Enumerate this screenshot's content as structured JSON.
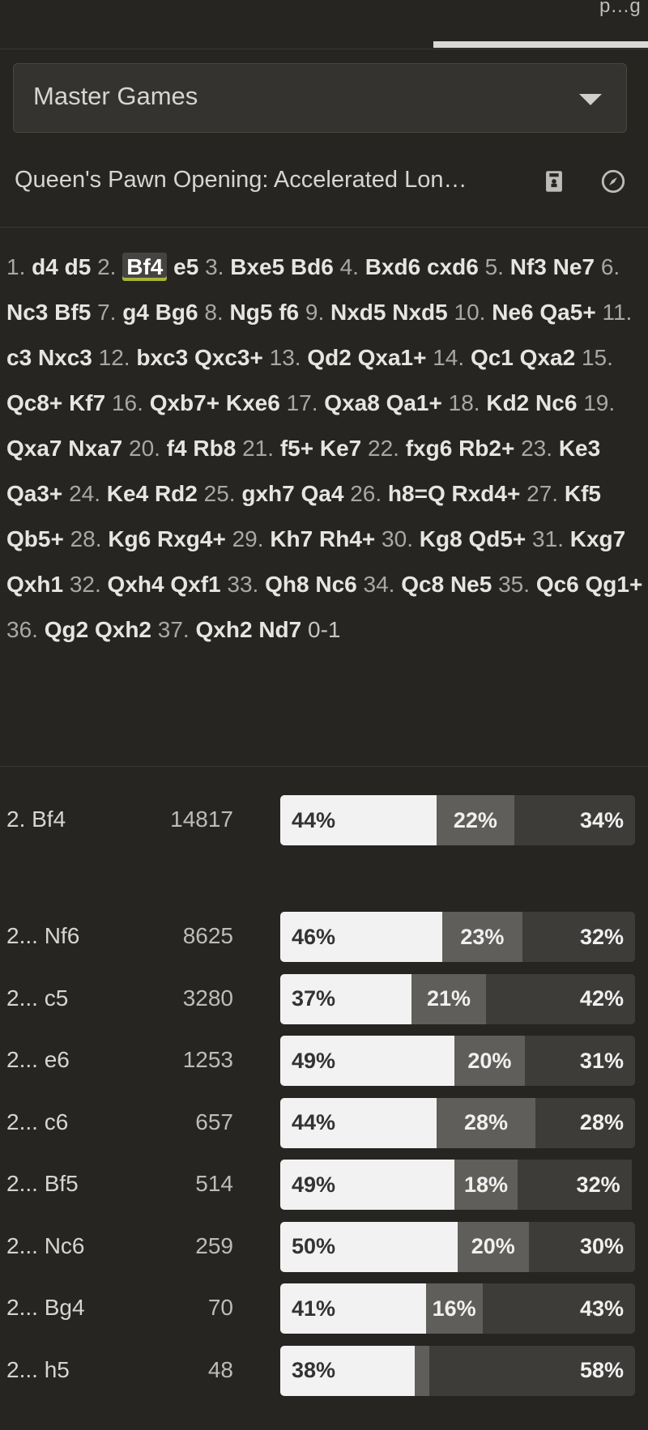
{
  "top": {
    "tab_clip": "p…g"
  },
  "source": {
    "selected": "Master Games"
  },
  "opening": {
    "name": "Queen's Pawn Opening: Accelerated Lon…"
  },
  "icons": {
    "book": "book-icon",
    "compass": "compass-icon",
    "chevron": "chevron-down-icon"
  },
  "colors": {
    "background": "#262522",
    "white": "#f2f2f2",
    "draw": "#5f5e5b",
    "black": "#3d3c39",
    "highlight": "#a9b33a"
  },
  "game_tokens": [
    {
      "t": "1.",
      "k": "num"
    },
    {
      "t": "d4",
      "k": "mv"
    },
    {
      "t": "d5",
      "k": "mv"
    },
    {
      "t": "2.",
      "k": "num"
    },
    {
      "t": "Bf4",
      "k": "mv",
      "current": true
    },
    {
      "t": "e5",
      "k": "mv"
    },
    {
      "t": "3.",
      "k": "num"
    },
    {
      "t": "Bxe5",
      "k": "mv"
    },
    {
      "t": "Bd6",
      "k": "mv"
    },
    {
      "t": "4.",
      "k": "num"
    },
    {
      "t": "Bxd6",
      "k": "mv"
    },
    {
      "t": "cxd6",
      "k": "mv"
    },
    {
      "t": "5.",
      "k": "num"
    },
    {
      "t": "Nf3",
      "k": "mv"
    },
    {
      "t": "Ne7",
      "k": "mv"
    },
    {
      "t": "6.",
      "k": "num"
    },
    {
      "t": "Nc3",
      "k": "mv"
    },
    {
      "t": "Bf5",
      "k": "mv"
    },
    {
      "t": "7.",
      "k": "num"
    },
    {
      "t": "g4",
      "k": "mv"
    },
    {
      "t": "Bg6",
      "k": "mv"
    },
    {
      "t": "8.",
      "k": "num"
    },
    {
      "t": "Ng5",
      "k": "mv"
    },
    {
      "t": "f6",
      "k": "mv"
    },
    {
      "t": "9.",
      "k": "num"
    },
    {
      "t": "Nxd5",
      "k": "mv"
    },
    {
      "t": "Nxd5",
      "k": "mv"
    },
    {
      "t": "10.",
      "k": "num"
    },
    {
      "t": "Ne6",
      "k": "mv"
    },
    {
      "t": "Qa5+",
      "k": "mv"
    },
    {
      "t": "11.",
      "k": "num"
    },
    {
      "t": "c3",
      "k": "mv"
    },
    {
      "t": "Nxc3",
      "k": "mv"
    },
    {
      "t": "12.",
      "k": "num"
    },
    {
      "t": "bxc3",
      "k": "mv"
    },
    {
      "t": "Qxc3+",
      "k": "mv"
    },
    {
      "t": "13.",
      "k": "num"
    },
    {
      "t": "Qd2",
      "k": "mv"
    },
    {
      "t": "Qxa1+",
      "k": "mv"
    },
    {
      "t": "14.",
      "k": "num"
    },
    {
      "t": "Qc1",
      "k": "mv"
    },
    {
      "t": "Qxa2",
      "k": "mv"
    },
    {
      "t": "15.",
      "k": "num"
    },
    {
      "t": "Qc8+",
      "k": "mv"
    },
    {
      "t": "Kf7",
      "k": "mv"
    },
    {
      "t": "16.",
      "k": "num"
    },
    {
      "t": "Qxb7+",
      "k": "mv"
    },
    {
      "t": "Kxe6",
      "k": "mv"
    },
    {
      "t": "17.",
      "k": "num"
    },
    {
      "t": "Qxa8",
      "k": "mv"
    },
    {
      "t": "Qa1+",
      "k": "mv"
    },
    {
      "t": "18.",
      "k": "num"
    },
    {
      "t": "Kd2",
      "k": "mv"
    },
    {
      "t": "Nc6",
      "k": "mv"
    },
    {
      "t": "19.",
      "k": "num"
    },
    {
      "t": "Qxa7",
      "k": "mv"
    },
    {
      "t": "Nxa7",
      "k": "mv"
    },
    {
      "t": "20.",
      "k": "num"
    },
    {
      "t": "f4",
      "k": "mv"
    },
    {
      "t": "Rb8",
      "k": "mv"
    },
    {
      "t": "21.",
      "k": "num"
    },
    {
      "t": "f5+",
      "k": "mv"
    },
    {
      "t": "Ke7",
      "k": "mv"
    },
    {
      "t": "22.",
      "k": "num"
    },
    {
      "t": "fxg6",
      "k": "mv"
    },
    {
      "t": "Rb2+",
      "k": "mv"
    },
    {
      "t": "23.",
      "k": "num"
    },
    {
      "t": "Ke3",
      "k": "mv"
    },
    {
      "t": "Qa3+",
      "k": "mv"
    },
    {
      "t": "24.",
      "k": "num"
    },
    {
      "t": "Ke4",
      "k": "mv"
    },
    {
      "t": "Rd2",
      "k": "mv"
    },
    {
      "t": "25.",
      "k": "num"
    },
    {
      "t": "gxh7",
      "k": "mv"
    },
    {
      "t": "Qa4",
      "k": "mv"
    },
    {
      "t": "26.",
      "k": "num"
    },
    {
      "t": "h8=Q",
      "k": "mv"
    },
    {
      "t": "Rxd4+",
      "k": "mv"
    },
    {
      "t": "27.",
      "k": "num"
    },
    {
      "t": "Kf5",
      "k": "mv"
    },
    {
      "t": "Qb5+",
      "k": "mv"
    },
    {
      "t": "28.",
      "k": "num"
    },
    {
      "t": "Kg6",
      "k": "mv"
    },
    {
      "t": "Rxg4+",
      "k": "mv"
    },
    {
      "t": "29.",
      "k": "num"
    },
    {
      "t": "Kh7",
      "k": "mv"
    },
    {
      "t": "Rh4+",
      "k": "mv"
    },
    {
      "t": "30.",
      "k": "num"
    },
    {
      "t": "Kg8",
      "k": "mv"
    },
    {
      "t": "Qd5+",
      "k": "mv"
    },
    {
      "t": "31.",
      "k": "num"
    },
    {
      "t": "Kxg7",
      "k": "mv"
    },
    {
      "t": "Qxh1",
      "k": "mv"
    },
    {
      "t": "32.",
      "k": "num"
    },
    {
      "t": "Qxh4",
      "k": "mv"
    },
    {
      "t": "Qxf1",
      "k": "mv"
    },
    {
      "t": "33.",
      "k": "num"
    },
    {
      "t": "Qh8",
      "k": "mv"
    },
    {
      "t": "Nc6",
      "k": "mv"
    },
    {
      "t": "34.",
      "k": "num"
    },
    {
      "t": "Qc8",
      "k": "mv"
    },
    {
      "t": "Ne5",
      "k": "mv"
    },
    {
      "t": "35.",
      "k": "num"
    },
    {
      "t": "Qc6",
      "k": "mv"
    },
    {
      "t": "Qg1+",
      "k": "mv"
    },
    {
      "t": "36.",
      "k": "num"
    },
    {
      "t": "Qg2",
      "k": "mv"
    },
    {
      "t": "Qxh2",
      "k": "mv"
    },
    {
      "t": "37.",
      "k": "num"
    },
    {
      "t": "Qxh2",
      "k": "mv"
    },
    {
      "t": "Nd7",
      "k": "mv"
    },
    {
      "t": "0-1",
      "k": "res"
    }
  ],
  "current_move": {
    "move": "2. Bf4",
    "games": "14817",
    "white": "44%",
    "draw": "22%",
    "black": "34%",
    "w": 44,
    "d": 22,
    "b": 34
  },
  "candidates": [
    {
      "move": "2... Nf6",
      "games": "8625",
      "white": "46%",
      "draw": "23%",
      "black": "32%",
      "w": 46,
      "d": 23,
      "b": 32
    },
    {
      "move": "2... c5",
      "games": "3280",
      "white": "37%",
      "draw": "21%",
      "black": "42%",
      "w": 37,
      "d": 21,
      "b": 42
    },
    {
      "move": "2... e6",
      "games": "1253",
      "white": "49%",
      "draw": "20%",
      "black": "31%",
      "w": 49,
      "d": 20,
      "b": 31
    },
    {
      "move": "2... c6",
      "games": "657",
      "white": "44%",
      "draw": "28%",
      "black": "28%",
      "w": 44,
      "d": 28,
      "b": 28
    },
    {
      "move": "2... Bf5",
      "games": "514",
      "white": "49%",
      "draw": "18%",
      "black": "32%",
      "w": 49,
      "d": 18,
      "b": 32
    },
    {
      "move": "2... Nc6",
      "games": "259",
      "white": "50%",
      "draw": "20%",
      "black": "30%",
      "w": 50,
      "d": 20,
      "b": 30
    },
    {
      "move": "2... Bg4",
      "games": "70",
      "white": "41%",
      "draw": "16%",
      "black": "43%",
      "w": 41,
      "d": 16,
      "b": 43
    },
    {
      "move": "2... h5",
      "games": "48",
      "white": "38%",
      "draw": "",
      "black": "58%",
      "w": 38,
      "d": 4,
      "b": 58
    }
  ]
}
